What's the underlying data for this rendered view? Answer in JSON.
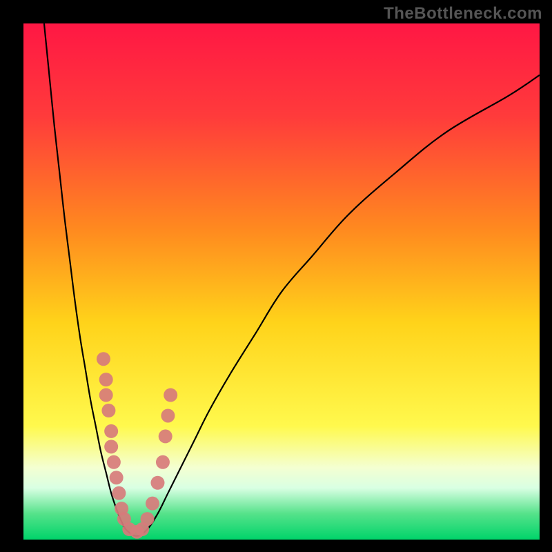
{
  "attribution": "TheBottleneck.com",
  "chart_data": {
    "type": "line",
    "title": "",
    "xlabel": "",
    "ylabel": "",
    "xlim": [
      0,
      100
    ],
    "ylim": [
      0,
      100
    ],
    "gradient_stops": [
      {
        "offset": 0,
        "color": "#ff1744"
      },
      {
        "offset": 18,
        "color": "#ff3b3b"
      },
      {
        "offset": 40,
        "color": "#ff8a1f"
      },
      {
        "offset": 58,
        "color": "#ffd31a"
      },
      {
        "offset": 78,
        "color": "#fff94d"
      },
      {
        "offset": 86,
        "color": "#f4ffd1"
      },
      {
        "offset": 90,
        "color": "#d9ffe3"
      },
      {
        "offset": 95,
        "color": "#55e28a"
      },
      {
        "offset": 100,
        "color": "#00d46a"
      }
    ],
    "series": [
      {
        "name": "bottleneck-curve",
        "x": [
          4,
          5,
          6,
          7,
          8,
          9,
          10,
          11,
          12,
          13,
          14,
          15,
          16,
          17,
          18,
          19,
          20,
          22,
          24,
          26,
          28,
          30,
          33,
          36,
          40,
          45,
          50,
          56,
          63,
          72,
          82,
          94,
          100
        ],
        "y": [
          100,
          90,
          80,
          71,
          62,
          54,
          46,
          39,
          33,
          27,
          22,
          17,
          13,
          9,
          6,
          3.5,
          1.8,
          0.7,
          2,
          5,
          9,
          13,
          19,
          25,
          32,
          40,
          48,
          55,
          63,
          71,
          79,
          86,
          90
        ]
      }
    ],
    "scatter": {
      "name": "data-points",
      "color": "#d77b7b",
      "points": [
        {
          "x": 15.5,
          "y": 35
        },
        {
          "x": 16.0,
          "y": 31
        },
        {
          "x": 16.0,
          "y": 28
        },
        {
          "x": 16.5,
          "y": 25
        },
        {
          "x": 17.0,
          "y": 21
        },
        {
          "x": 17.0,
          "y": 18
        },
        {
          "x": 17.5,
          "y": 15
        },
        {
          "x": 18.0,
          "y": 12
        },
        {
          "x": 18.5,
          "y": 9
        },
        {
          "x": 19.0,
          "y": 6
        },
        {
          "x": 19.5,
          "y": 4
        },
        {
          "x": 20.5,
          "y": 2
        },
        {
          "x": 22.0,
          "y": 1.5
        },
        {
          "x": 23.0,
          "y": 2
        },
        {
          "x": 24.0,
          "y": 4
        },
        {
          "x": 25.0,
          "y": 7
        },
        {
          "x": 26.0,
          "y": 11
        },
        {
          "x": 27.0,
          "y": 15
        },
        {
          "x": 27.5,
          "y": 20
        },
        {
          "x": 28.0,
          "y": 24
        },
        {
          "x": 28.5,
          "y": 28
        }
      ]
    }
  }
}
